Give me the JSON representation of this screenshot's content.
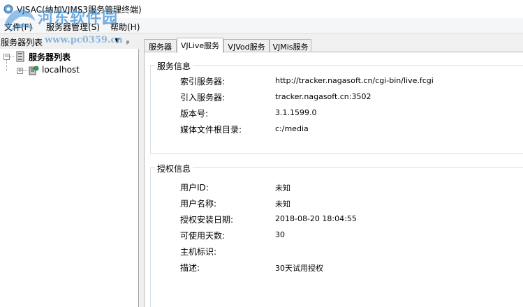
{
  "window": {
    "title": "VJSAC(纳加VJMS3服务管理终端)"
  },
  "menu": {
    "items": [
      "文件(F)",
      "服务器管理(S)",
      "帮助(H)"
    ]
  },
  "watermark": {
    "main": "河东软件园",
    "url": "www.pc0359.cn"
  },
  "left_panel": {
    "title": "服务器列表",
    "pin": "ₚ",
    "tree": {
      "root": "服务器列表",
      "child": "localhost"
    }
  },
  "tabs": [
    "服务器",
    "VJLive服务",
    "VJVod服务",
    "VJMis服务"
  ],
  "active_tab": 1,
  "service_info": {
    "title": "服务信息",
    "rows": [
      {
        "label": "索引服务器:",
        "value": "http://tracker.nagasoft.cn/cgi-bin/live.fcgi"
      },
      {
        "label": "引入服务器:",
        "value": "tracker.nagasoft.cn:3502"
      },
      {
        "label": "版本号:",
        "value": "3.1.1599.0"
      },
      {
        "label": "媒体文件根目录:",
        "value": "c:/media"
      }
    ]
  },
  "license_info": {
    "title": "授权信息",
    "rows": [
      {
        "label": "用户ID:",
        "value": "未知"
      },
      {
        "label": "用户名称:",
        "value": "未知"
      },
      {
        "label": "授权安装日期:",
        "value": "2018-08-20 18:04:55"
      },
      {
        "label": "可使用天数:",
        "value": "30"
      },
      {
        "label": "主机标识:",
        "value": ""
      },
      {
        "label": "描述:",
        "value": "30天试用授权"
      }
    ]
  }
}
